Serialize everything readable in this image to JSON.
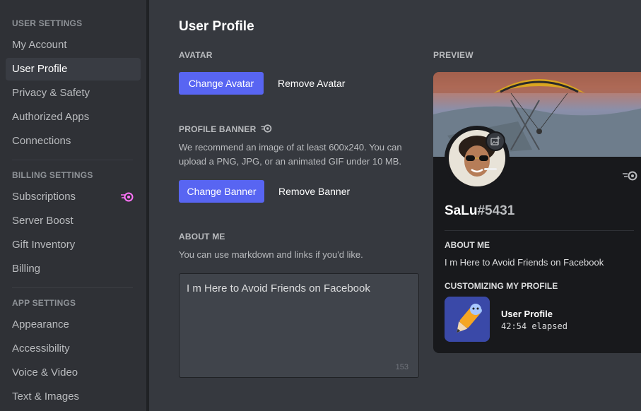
{
  "sidebar": {
    "user_settings_header": "USER SETTINGS",
    "user_items": [
      "My Account",
      "User Profile",
      "Privacy & Safety",
      "Authorized Apps",
      "Connections"
    ],
    "billing_settings_header": "BILLING SETTINGS",
    "billing_items": [
      "Subscriptions",
      "Server Boost",
      "Gift Inventory",
      "Billing"
    ],
    "app_settings_header": "APP SETTINGS",
    "app_items": [
      "Appearance",
      "Accessibility",
      "Voice & Video",
      "Text & Images"
    ],
    "active_item": "User Profile"
  },
  "main": {
    "title": "User Profile",
    "avatar_label": "AVATAR",
    "change_avatar": "Change Avatar",
    "remove_avatar": "Remove Avatar",
    "banner_label": "PROFILE BANNER",
    "banner_desc_line1": "We recommend an image of at least 600x240. You can",
    "banner_desc_line2": "upload a PNG, JPG, or an animated GIF under 10 MB.",
    "change_banner": "Change Banner",
    "remove_banner": "Remove Banner",
    "about_label": "ABOUT ME",
    "about_desc": "You can use markdown and links if you'd like.",
    "about_value": "I m Here to Avoid Friends on Facebook",
    "char_remaining": "153",
    "preview_label": "PREVIEW"
  },
  "preview": {
    "username": "SaLu",
    "discriminator": "#5431",
    "about_label": "ABOUT ME",
    "about_text": "I m Here to Avoid Friends on Facebook",
    "activity_label": "CUSTOMIZING MY PROFILE",
    "activity_title": "User Profile",
    "activity_time": "42:54 elapsed"
  },
  "colors": {
    "accent": "#5865f2",
    "nitro_pink": "#ff73fa",
    "background": "#36393f",
    "sidebar": "#2f3136",
    "card": "#18191c"
  }
}
